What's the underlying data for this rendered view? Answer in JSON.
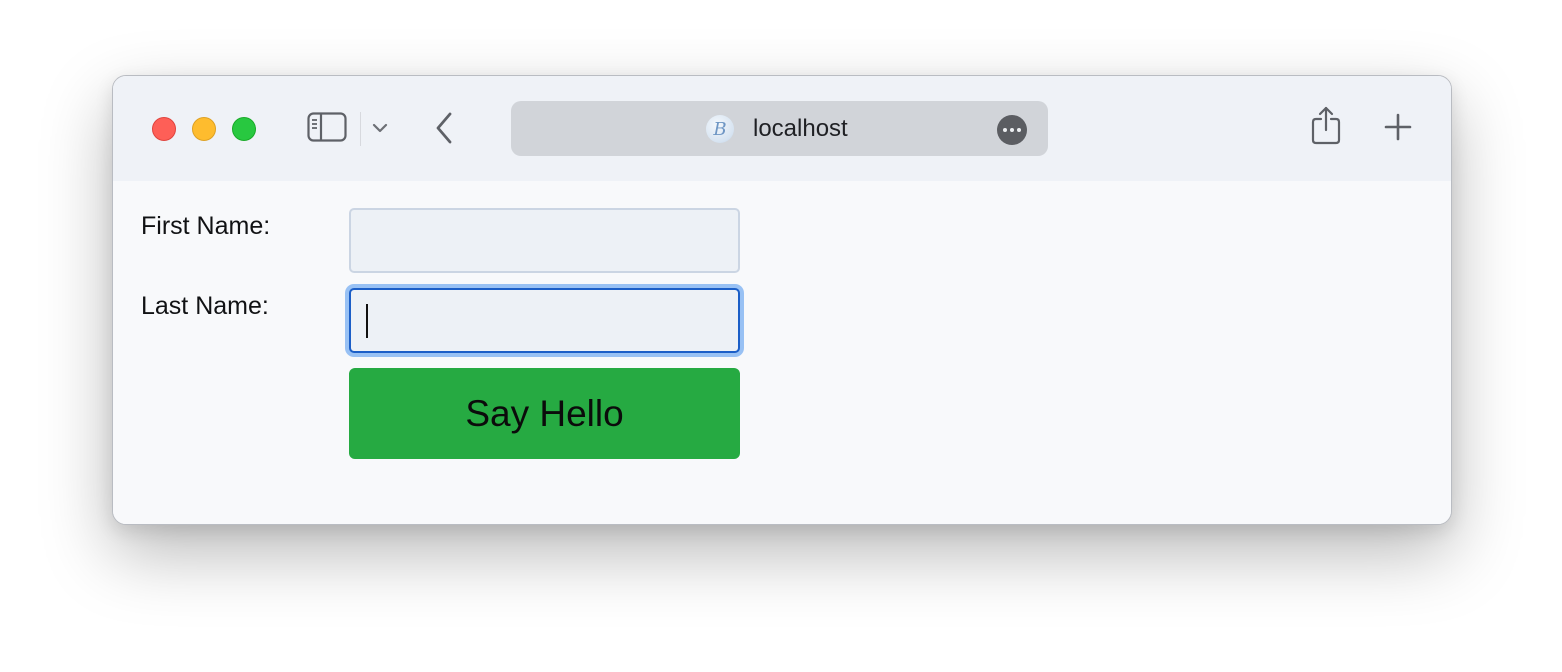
{
  "browser": {
    "address": "localhost",
    "site_icon": "B",
    "icons": {
      "sidebar": "sidebar-icon",
      "chevron": "chevron-down-icon",
      "back": "back-arrow-icon",
      "more": "more-options-icon",
      "share": "share-icon",
      "new_tab": "plus-icon"
    }
  },
  "form": {
    "first_name_label": "First Name:",
    "first_name_value": "",
    "last_name_label": "Last Name:",
    "last_name_value": "",
    "submit_label": "Say Hello"
  },
  "colors": {
    "button": "#26aa42",
    "focus_ring": "#98c1f4",
    "close": "#fe5f57",
    "minimize": "#febc2e",
    "maximize": "#28c840"
  }
}
